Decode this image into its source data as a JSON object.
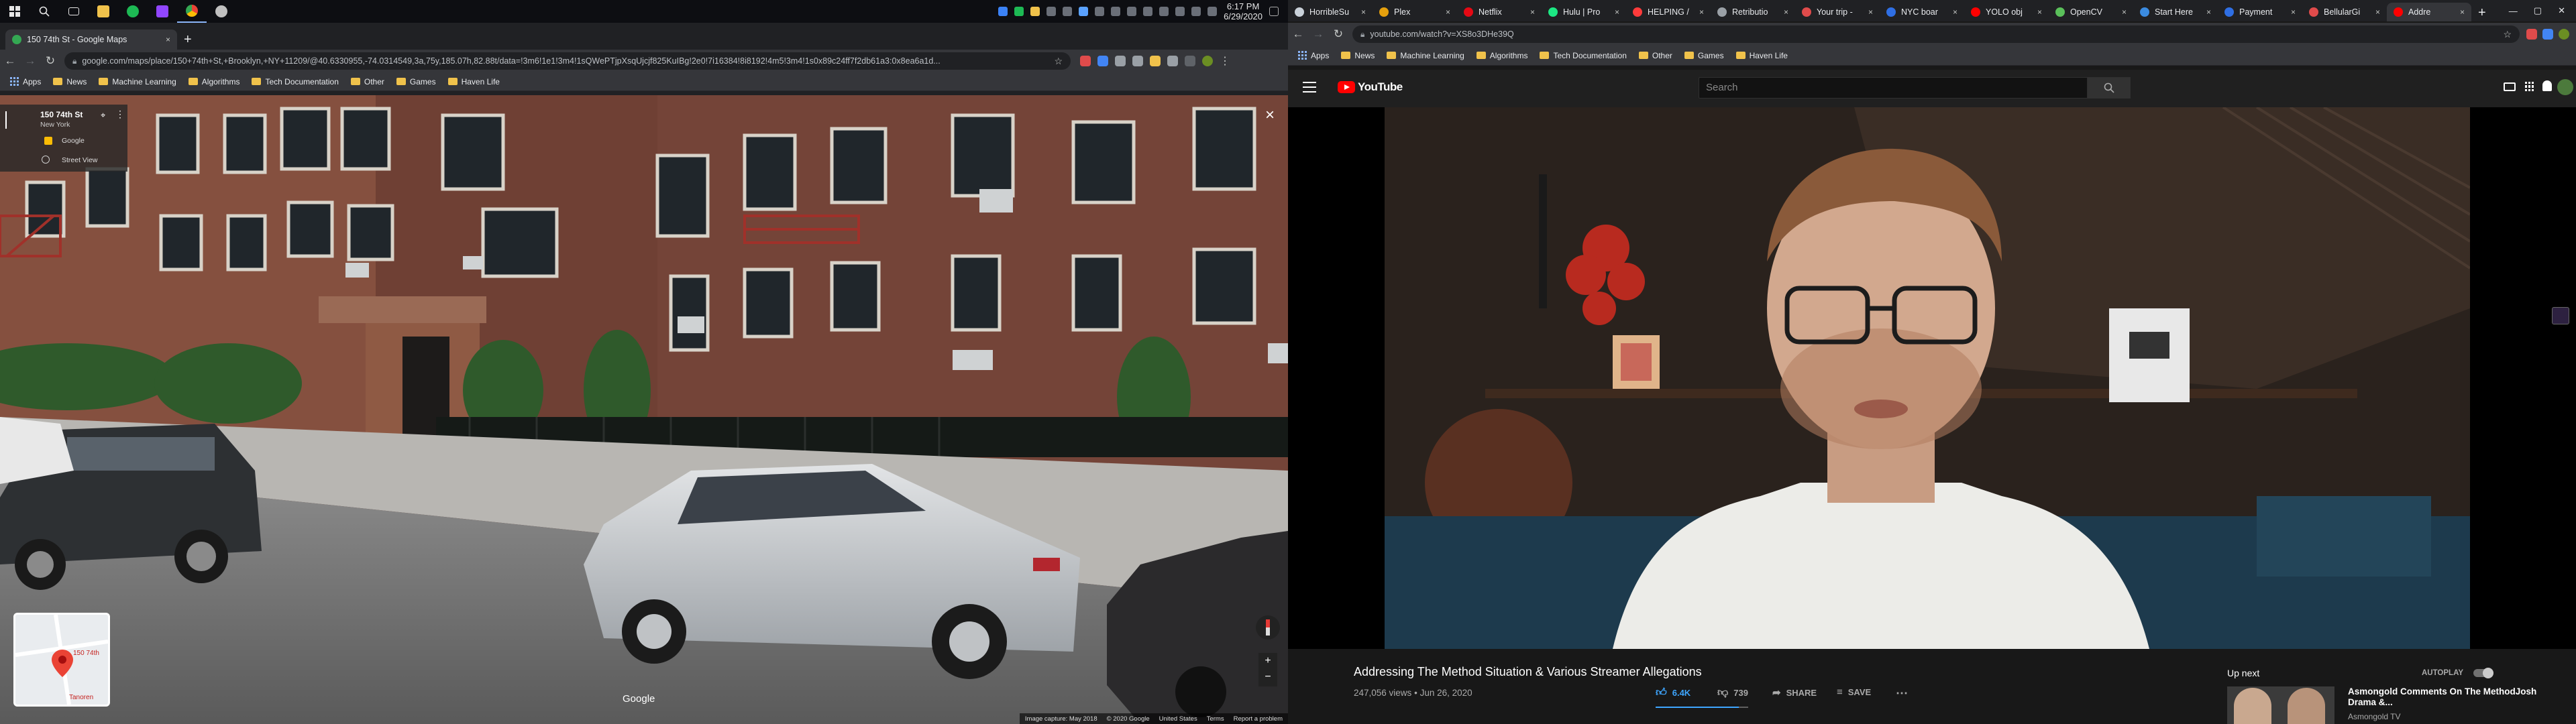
{
  "left": {
    "taskbar": {
      "clock_time": "6:17 PM",
      "clock_date": "6/29/2020"
    },
    "tab": {
      "title": "150 74th St - Google Maps",
      "close": "×",
      "new_tab": "+"
    },
    "url": "google.com/maps/place/150+74th+St,+Brooklyn,+NY+11209/@40.6330955,-74.0314549,3a,75y,185.07h,82.88t/data=!3m6!1e1!3m4!1sQWePTjpXsqUjcjf825KuIBg!2e0!7i16384!8i8192!4m5!3m4!1s0x89c24ff7f2db61a3:0x8ea6a1d...",
    "bookmarks": {
      "apps": "Apps",
      "items": [
        "News",
        "Machine Learning",
        "Algorithms",
        "Tech Documentation",
        "Other",
        "Games",
        "Haven Life"
      ]
    },
    "streetview": {
      "address": "150 74th St",
      "city": "New York",
      "source": "Google",
      "mode": "Street View",
      "watermark": "Google",
      "minimap_label": "150 74th",
      "minimap_label2": "Tanoren",
      "close": "×",
      "footer": [
        "Image capture: May 2018",
        "© 2020 Google",
        "United States",
        "Terms",
        "Report a problem"
      ]
    }
  },
  "right": {
    "tabs": [
      {
        "title": "HorribleSu",
        "color": "#c9d1d9"
      },
      {
        "title": "Plex",
        "color": "#e5a00d"
      },
      {
        "title": "Netflix",
        "color": "#e50914"
      },
      {
        "title": "Hulu | Pro",
        "color": "#1ce783"
      },
      {
        "title": "HELPING /",
        "color": "#ff3b3b"
      },
      {
        "title": "Retributio",
        "color": "#9aa0a6"
      },
      {
        "title": "Your trip -",
        "color": "#e04b4b"
      },
      {
        "title": "NYC boar",
        "color": "#2f6fe4"
      },
      {
        "title": "YOLO obj",
        "color": "#ff0000"
      },
      {
        "title": "OpenCV",
        "color": "#5ac05a"
      },
      {
        "title": "Start Here",
        "color": "#3b8be0"
      },
      {
        "title": "Payment",
        "color": "#2f6fe4"
      },
      {
        "title": "BellularGi",
        "color": "#e04b4b"
      },
      {
        "title": "Addre",
        "color": "#ff0000"
      }
    ],
    "tab_close": "×",
    "new_tab": "+",
    "url": "youtube.com/watch?v=XS8o3DHe39Q",
    "bookmarks": {
      "apps": "Apps",
      "items": [
        "News",
        "Machine Learning",
        "Algorithms",
        "Tech Documentation",
        "Other",
        "Games",
        "Haven Life"
      ]
    },
    "youtube": {
      "logo_text": "YouTube",
      "search_placeholder": "Search",
      "video_title": "Addressing The Method Situation & Various Streamer Allegations",
      "views": "247,056 views",
      "date": "Jun 26, 2020",
      "likes": "6.4K",
      "dislikes": "739",
      "share": "SHARE",
      "save": "SAVE",
      "up_next": "Up next",
      "autoplay": "AUTOPLAY",
      "next_title": "Asmongold Comments On The MethodJosh Drama &...",
      "next_channel": "Asmongold TV"
    }
  }
}
